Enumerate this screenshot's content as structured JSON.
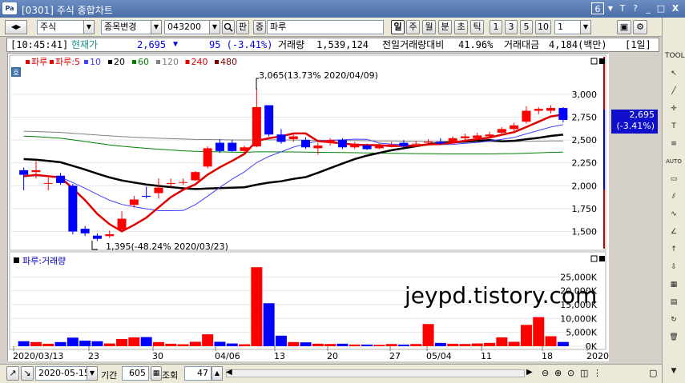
{
  "window": {
    "logo": "Pa",
    "title": "[0301] 주식 종합차트",
    "page_indicator": "6",
    "controls": [
      "▼",
      "T",
      "?",
      "_",
      "□",
      "X"
    ]
  },
  "toolbar": {
    "market": "주식",
    "stock_change_label": "종목변경",
    "code": "043200",
    "search_icon": "magnifier-icon",
    "pan_label": "판",
    "jeung_label": "증",
    "stock_name": "파루",
    "periods": [
      "일",
      "주",
      "월",
      "분",
      "초",
      "틱"
    ],
    "active_period": "일",
    "minute_intervals": [
      "1",
      "3",
      "5",
      "10"
    ],
    "interval_value": "1"
  },
  "quote": {
    "time": "[10:45:41]",
    "current_label": "현재가",
    "price": "2,695",
    "arrow": "▼",
    "change": "95 (-3.41%)",
    "volume_label": "거래량",
    "volume": "1,539,124",
    "prev_vol_label": "전일거래량대비",
    "prev_vol_ratio": "41.96%",
    "amount_label": "거래대금",
    "amount": "4,184(백만)",
    "period_tag": "[1일]"
  },
  "legend": {
    "ho": "호",
    "items": [
      {
        "label": "파루",
        "color": "#e00000"
      },
      {
        "label": "파루:5",
        "color": "#e00000"
      },
      {
        "label": "10",
        "color": "#4040ff"
      },
      {
        "label": "20",
        "color": "#000000"
      },
      {
        "label": "60",
        "color": "#008000"
      },
      {
        "label": "120",
        "color": "#808080"
      },
      {
        "label": "240",
        "color": "#e00000"
      },
      {
        "label": "480",
        "color": "#800000"
      }
    ]
  },
  "volume_legend": "파루:거래량",
  "watermark": "jeypd.tistory.com",
  "annotations": {
    "high": "3,065(13.73% 2020/04/09)",
    "low": "1,395(-48.24% 2020/03/23)"
  },
  "price_marker": {
    "price": "2,695",
    "change": "(-3.41%)"
  },
  "x_labels": [
    "2020/03/13",
    "23",
    "30",
    "04/06",
    "13",
    "20",
    "27",
    "05/04",
    "11",
    "18",
    "2020/05/22"
  ],
  "bottombar": {
    "date": "2020-05-15",
    "period_label": "기간",
    "period_value": "605",
    "query_label": "조회",
    "query_value": "47"
  },
  "colors": {
    "up": "#ff0000",
    "down": "#0000ff",
    "ma5": "#e00000",
    "ma10": "#4040ff",
    "ma20": "#000000",
    "ma60": "#008000",
    "ma120": "#808080"
  },
  "chart_data": {
    "type": "candlestick",
    "price_axis": {
      "ticks": [
        3000,
        2750,
        2500,
        2250,
        2000,
        1750,
        1500
      ],
      "labels": [
        "3,000",
        "2,750",
        "2,500",
        "2,250",
        "2,000",
        "1,750",
        "1,500"
      ],
      "ylim": [
        1330,
        3270
      ]
    },
    "volume_axis": {
      "ticks": [
        25000,
        20000,
        15000,
        10000,
        5000,
        0
      ],
      "labels": [
        "25,000K",
        "20,000K",
        "15,000K",
        "10,000K",
        "5,000K",
        "0K"
      ],
      "ylim": [
        0,
        30000
      ]
    },
    "candles": [
      {
        "o": 2170,
        "c": 2120,
        "h": 2200,
        "l": 1950,
        "v": 1800
      },
      {
        "o": 2150,
        "c": 2170,
        "h": 2270,
        "l": 2080,
        "v": 1500
      },
      {
        "o": 2030,
        "c": 2030,
        "h": 2090,
        "l": 1950,
        "v": 900
      },
      {
        "o": 2110,
        "c": 2030,
        "h": 2140,
        "l": 2010,
        "v": 1500
      },
      {
        "o": 2000,
        "c": 1500,
        "h": 2020,
        "l": 1470,
        "v": 3100
      },
      {
        "o": 1530,
        "c": 1480,
        "h": 1560,
        "l": 1450,
        "v": 2000
      },
      {
        "o": 1455,
        "c": 1420,
        "h": 1480,
        "l": 1395,
        "v": 1800
      },
      {
        "o": 1450,
        "c": 1470,
        "h": 1510,
        "l": 1430,
        "v": 1000
      },
      {
        "o": 1520,
        "c": 1640,
        "h": 1720,
        "l": 1520,
        "v": 2600
      },
      {
        "o": 1790,
        "c": 1850,
        "h": 1890,
        "l": 1760,
        "v": 3200
      },
      {
        "o": 1890,
        "c": 1880,
        "h": 1990,
        "l": 1860,
        "v": 3300
      },
      {
        "o": 1920,
        "c": 1980,
        "h": 2080,
        "l": 1860,
        "v": 1500
      },
      {
        "o": 2020,
        "c": 2030,
        "h": 2080,
        "l": 1990,
        "v": 900
      },
      {
        "o": 2040,
        "c": 2040,
        "h": 2080,
        "l": 2010,
        "v": 700
      },
      {
        "o": 2060,
        "c": 2150,
        "h": 2160,
        "l": 2050,
        "v": 1600
      },
      {
        "o": 2210,
        "c": 2410,
        "h": 2430,
        "l": 2190,
        "v": 4300
      },
      {
        "o": 2470,
        "c": 2380,
        "h": 2510,
        "l": 2360,
        "v": 1600
      },
      {
        "o": 2470,
        "c": 2380,
        "h": 2500,
        "l": 2370,
        "v": 1000
      },
      {
        "o": 2380,
        "c": 2420,
        "h": 2440,
        "l": 2360,
        "v": 700
      },
      {
        "o": 2430,
        "c": 2860,
        "h": 3065,
        "l": 2420,
        "v": 28500
      },
      {
        "o": 2880,
        "c": 2560,
        "h": 2880,
        "l": 2540,
        "v": 15500
      },
      {
        "o": 2560,
        "c": 2480,
        "h": 2620,
        "l": 2460,
        "v": 3800
      },
      {
        "o": 2510,
        "c": 2540,
        "h": 2560,
        "l": 2480,
        "v": 1500
      },
      {
        "o": 2500,
        "c": 2420,
        "h": 2530,
        "l": 2400,
        "v": 1400
      },
      {
        "o": 2410,
        "c": 2440,
        "h": 2470,
        "l": 2340,
        "v": 900
      },
      {
        "o": 2470,
        "c": 2500,
        "h": 2520,
        "l": 2440,
        "v": 800
      },
      {
        "o": 2500,
        "c": 2420,
        "h": 2520,
        "l": 2400,
        "v": 900
      },
      {
        "o": 2420,
        "c": 2460,
        "h": 2480,
        "l": 2400,
        "v": 600
      },
      {
        "o": 2440,
        "c": 2400,
        "h": 2460,
        "l": 2390,
        "v": 600
      },
      {
        "o": 2410,
        "c": 2440,
        "h": 2460,
        "l": 2400,
        "v": 500
      },
      {
        "o": 2440,
        "c": 2450,
        "h": 2480,
        "l": 2420,
        "v": 800
      },
      {
        "o": 2470,
        "c": 2430,
        "h": 2500,
        "l": 2420,
        "v": 600
      },
      {
        "o": 2460,
        "c": 2460,
        "h": 2490,
        "l": 2440,
        "v": 800
      },
      {
        "o": 2470,
        "c": 2480,
        "h": 2510,
        "l": 2450,
        "v": 8000
      },
      {
        "o": 2480,
        "c": 2460,
        "h": 2520,
        "l": 2450,
        "v": 1200
      },
      {
        "o": 2480,
        "c": 2520,
        "h": 2540,
        "l": 2460,
        "v": 900
      },
      {
        "o": 2520,
        "c": 2540,
        "h": 2570,
        "l": 2500,
        "v": 800
      },
      {
        "o": 2520,
        "c": 2550,
        "h": 2580,
        "l": 2500,
        "v": 1000
      },
      {
        "o": 2540,
        "c": 2560,
        "h": 2590,
        "l": 2520,
        "v": 1200
      },
      {
        "o": 2580,
        "c": 2620,
        "h": 2640,
        "l": 2560,
        "v": 3200
      },
      {
        "o": 2620,
        "c": 2660,
        "h": 2690,
        "l": 2600,
        "v": 1600
      },
      {
        "o": 2700,
        "c": 2820,
        "h": 2870,
        "l": 2680,
        "v": 7700
      },
      {
        "o": 2820,
        "c": 2840,
        "h": 2860,
        "l": 2780,
        "v": 10500
      },
      {
        "o": 2820,
        "c": 2850,
        "h": 2880,
        "l": 2790,
        "v": 3600
      },
      {
        "o": 2850,
        "c": 2720,
        "h": 2860,
        "l": 2690,
        "v": 1540
      }
    ]
  }
}
